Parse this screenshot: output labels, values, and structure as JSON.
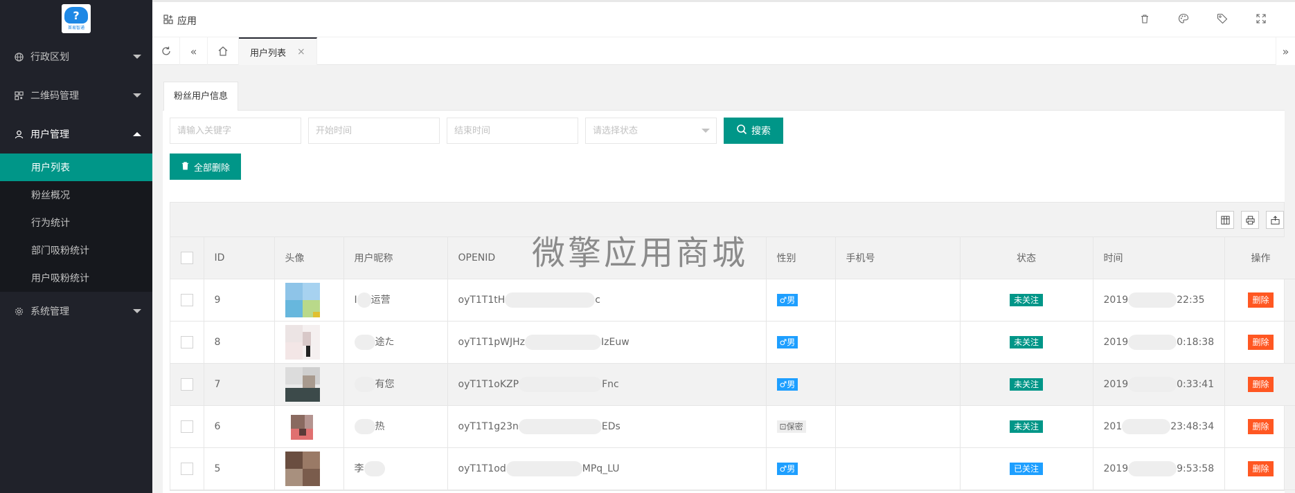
{
  "logo": {
    "text": "首易智通"
  },
  "sidebar": {
    "menus": [
      {
        "label": "行政区划",
        "icon": "globe-icon"
      },
      {
        "label": "二维码管理",
        "icon": "qrcode-icon"
      },
      {
        "label": "用户管理",
        "icon": "user-icon"
      }
    ],
    "sub_items": [
      {
        "label": "用户列表"
      },
      {
        "label": "粉丝概况"
      },
      {
        "label": "行为统计"
      },
      {
        "label": "部门吸粉统计"
      },
      {
        "label": "用户吸粉统计"
      }
    ],
    "system": {
      "label": "系统管理",
      "icon": "gear-icon"
    }
  },
  "header": {
    "app_label": "应用",
    "icons": [
      "trash-icon",
      "palette-icon",
      "tag-icon",
      "fullscreen-icon"
    ]
  },
  "tabs": {
    "active": "用户列表",
    "close": "×"
  },
  "card": {
    "tab": "粉丝用户信息",
    "filters": {
      "keyword_placeholder": "请输入关键字",
      "start_placeholder": "开始时间",
      "end_placeholder": "结束时间",
      "status_placeholder": "请选择状态",
      "search_label": "搜索"
    },
    "delete_all_label": "全部删除"
  },
  "table": {
    "headers": [
      "ID",
      "头像",
      "用户昵称",
      "OPENID",
      "性别",
      "手机号",
      "状态",
      "时间",
      "操作"
    ],
    "rows": [
      {
        "id": "9",
        "nick_pre": "I",
        "nick_post": "运营",
        "openid_pre": "oyT1T1tH",
        "openid_post": "c",
        "gender": "♂男",
        "status": "未关注",
        "time_pre": "2019",
        "time_post": "22:35",
        "action": "删除"
      },
      {
        "id": "8",
        "nick_pre": "",
        "nick_post": "途た",
        "openid_pre": "oyT1T1pWJHz",
        "openid_post": "IzEuw",
        "gender": "♂男",
        "status": "未关注",
        "time_pre": "2019",
        "time_post": "0:18:38",
        "action": "删除"
      },
      {
        "id": "7",
        "nick_pre": "",
        "nick_post": "有您",
        "openid_pre": "oyT1T1oKZP",
        "openid_post": "Fnc",
        "gender": "♂男",
        "status": "未关注",
        "time_pre": "2019",
        "time_post": "0:33:41",
        "action": "删除"
      },
      {
        "id": "6",
        "nick_pre": "",
        "nick_post": "热",
        "openid_pre": "oyT1T1g23n",
        "openid_post": "EDs",
        "gender": "保密",
        "status": "未关注",
        "time_pre": "201",
        "time_post": "23:48:34",
        "action": "删除"
      },
      {
        "id": "5",
        "nick_pre": "李",
        "nick_post": "",
        "openid_pre": "oyT1T1od",
        "openid_post": "MPq_LU",
        "gender": "♂男",
        "status": "已关注",
        "time_pre": "2019",
        "time_post": "9:53:58",
        "action": "删除"
      }
    ]
  },
  "watermark": "微擎应用商城",
  "colors": {
    "primary": "#009688",
    "sidebar": "#20222a",
    "danger": "#ff5722",
    "blue": "#1e9fff"
  }
}
